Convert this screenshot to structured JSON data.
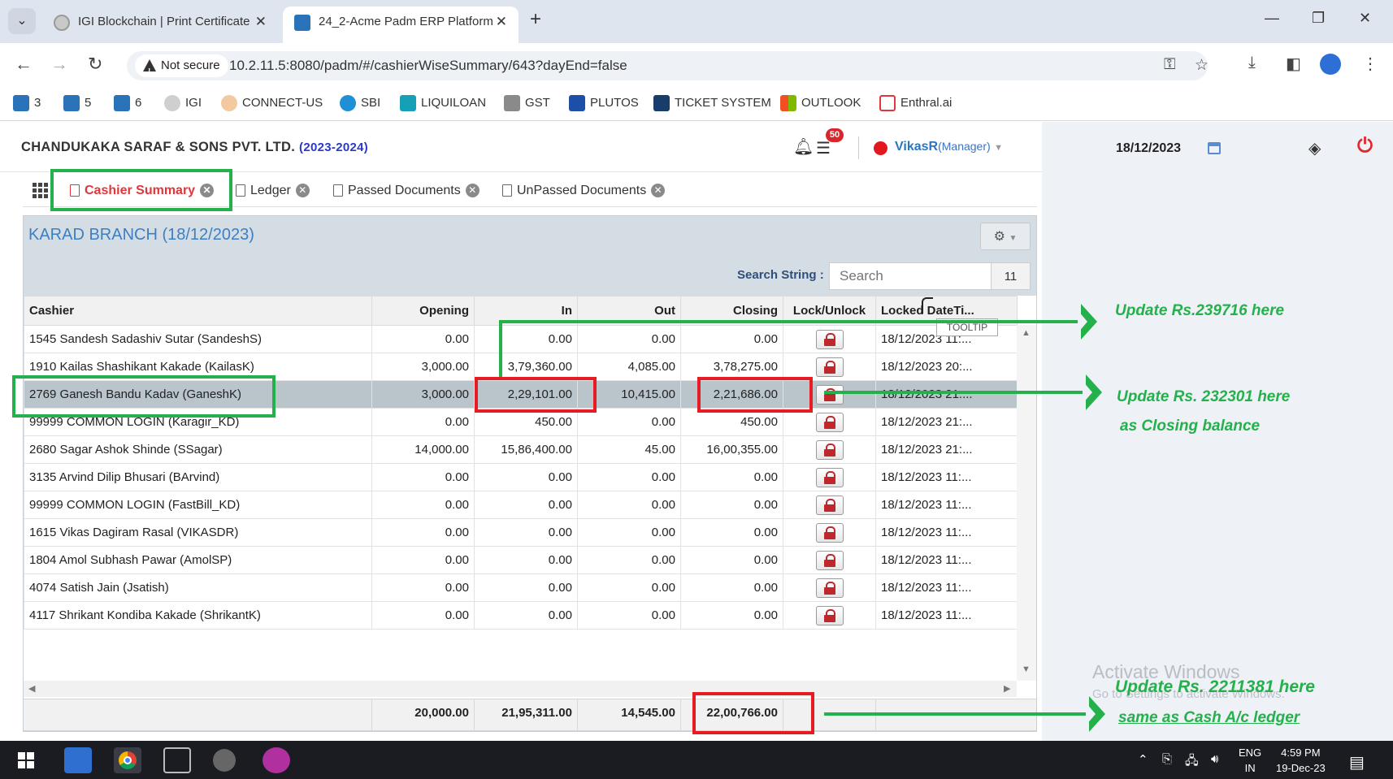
{
  "browser": {
    "tabs": [
      {
        "title": "IGI Blockchain | Print Certificate",
        "active": false
      },
      {
        "title": "24_2-Acme Padm ERP Platform",
        "active": true
      }
    ],
    "security_label": "Not secure",
    "url": "10.2.11.5:8080/padm/#/cashierWiseSummary/643?dayEnd=false",
    "bookmarks": [
      "3",
      "5",
      "6",
      "IGI",
      "CONNECT-US",
      "SBI",
      "LIQUILOAN",
      "GST",
      "PLUTOS",
      "TICKET SYSTEM",
      "OUTLOOK",
      "Enthral.ai"
    ]
  },
  "header": {
    "company": "CHANDUKAKA SARAF & SONS PVT. LTD.",
    "year": "(2023-2024)",
    "notification_count": "50",
    "user": "VikasR",
    "role": "(Manager)",
    "date": "18/12/2023"
  },
  "app_tabs": [
    {
      "label": "Cashier Summary",
      "active": true
    },
    {
      "label": "Ledger",
      "active": false
    },
    {
      "label": "Passed Documents",
      "active": false
    },
    {
      "label": "UnPassed Documents",
      "active": false
    }
  ],
  "panel": {
    "title": "KARAD BRANCH (18/12/2023)",
    "search_label": "Search String :",
    "search_placeholder": "Search",
    "result_count": "11",
    "tooltip": "TOOLTIP"
  },
  "table": {
    "columns": [
      "Cashier",
      "Opening",
      "In",
      "Out",
      "Closing",
      "Lock/Unlock",
      "Locked DateTi..."
    ],
    "rows": [
      {
        "cashier": "1545 Sandesh Sadashiv Sutar (SandeshS)",
        "opening": "0.00",
        "in": "0.00",
        "out": "0.00",
        "closing": "0.00",
        "locked": "18/12/2023 11:..."
      },
      {
        "cashier": "1910 Kailas Shashikant Kakade (KailasK)",
        "opening": "3,000.00",
        "in": "3,79,360.00",
        "out": "4,085.00",
        "closing": "3,78,275.00",
        "locked": "18/12/2023 20:..."
      },
      {
        "cashier": "2769 Ganesh Bandu Kadav (GaneshK)",
        "opening": "3,000.00",
        "in": "2,29,101.00",
        "out": "10,415.00",
        "closing": "2,21,686.00",
        "locked": "18/12/2023 21:..."
      },
      {
        "cashier": "99999 COMMON LOGIN (Karagir_KD)",
        "opening": "0.00",
        "in": "450.00",
        "out": "0.00",
        "closing": "450.00",
        "locked": "18/12/2023 21:..."
      },
      {
        "cashier": "2680 Sagar Ashok Shinde (SSagar)",
        "opening": "14,000.00",
        "in": "15,86,400.00",
        "out": "45.00",
        "closing": "16,00,355.00",
        "locked": "18/12/2023 21:..."
      },
      {
        "cashier": "3135 Arvind Dilip Bhusari (BArvind)",
        "opening": "0.00",
        "in": "0.00",
        "out": "0.00",
        "closing": "0.00",
        "locked": "18/12/2023 11:..."
      },
      {
        "cashier": "99999 COMMON LOGIN (FastBill_KD)",
        "opening": "0.00",
        "in": "0.00",
        "out": "0.00",
        "closing": "0.00",
        "locked": "18/12/2023 11:..."
      },
      {
        "cashier": "1615 Vikas Dagiram Rasal (VIKASDR)",
        "opening": "0.00",
        "in": "0.00",
        "out": "0.00",
        "closing": "0.00",
        "locked": "18/12/2023 11:..."
      },
      {
        "cashier": "1804 Amol Subhash Pawar (AmolSP)",
        "opening": "0.00",
        "in": "0.00",
        "out": "0.00",
        "closing": "0.00",
        "locked": "18/12/2023 11:..."
      },
      {
        "cashier": "4074 Satish Jain (Jsatish)",
        "opening": "0.00",
        "in": "0.00",
        "out": "0.00",
        "closing": "0.00",
        "locked": "18/12/2023 11:..."
      },
      {
        "cashier": "4117 Shrikant Kondiba Kakade (ShrikantK)",
        "opening": "0.00",
        "in": "0.00",
        "out": "0.00",
        "closing": "0.00",
        "locked": "18/12/2023 11:..."
      }
    ],
    "totals": {
      "opening": "20,000.00",
      "in": "21,95,311.00",
      "out": "14,545.00",
      "closing": "22,00,766.00"
    }
  },
  "annotations": {
    "note1": "Update Rs.239716 here",
    "note2_line1": "Update Rs. 232301 here",
    "note2_line2": "as Closing balance",
    "note3_line1": "Update Rs. 2211381 here",
    "note3_line2": "same as Cash A/c ledger",
    "color_green": "#24b14c",
    "color_red": "#e51c24"
  },
  "watermark": {
    "line1": "Activate Windows",
    "line2": "Go to Settings to activate Windows."
  },
  "taskbar": {
    "lang": "ENG",
    "region": "IN",
    "time": "4:59 PM",
    "date": "19-Dec-23"
  }
}
